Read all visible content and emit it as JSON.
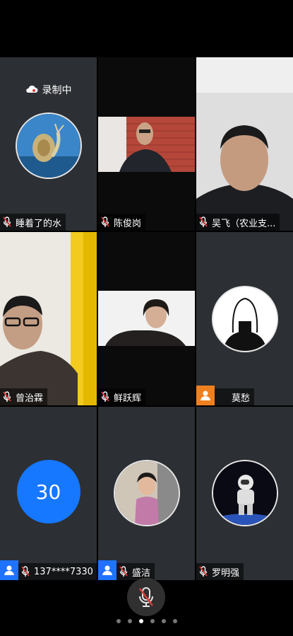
{
  "recording": {
    "label": "录制中"
  },
  "participants": [
    {
      "name": "睡着了的水"
    },
    {
      "name": "陈俊岗"
    },
    {
      "name": "吴飞（农业支..."
    },
    {
      "name": "曾治霖"
    },
    {
      "name": "鲜跃辉"
    },
    {
      "name": "莫愁"
    },
    {
      "name": "137****7330",
      "avatar_text": "30"
    },
    {
      "name": "盛洁"
    },
    {
      "name": "罗明强"
    }
  ],
  "pager": {
    "pages": 6,
    "current": 3
  },
  "colors": {
    "host_orange": "#f0801e",
    "host_blue": "#1f73ff",
    "mic_red": "#e23a3a",
    "avatar_blue": "#1677ff"
  }
}
